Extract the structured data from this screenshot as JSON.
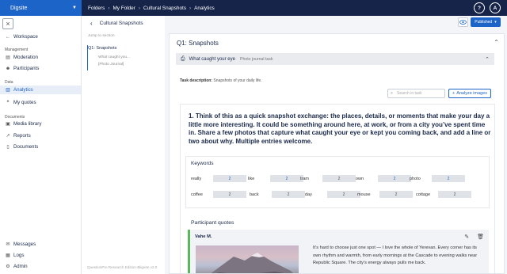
{
  "app": {
    "brand": "Digsite",
    "breadcrumbs": [
      "Folders",
      "My Folder",
      "Cultural Snapshots",
      "Analytics"
    ],
    "help_label": "?",
    "avatar_label": "A"
  },
  "sidebar": {
    "workspace": "Workspace",
    "section_management": "Management",
    "moderation": "Moderation",
    "participants": "Participants",
    "section_data": "Data",
    "analytics": "Analytics",
    "my_quotes": "My quotes",
    "section_documents": "Documents",
    "media_library": "Media library",
    "reports": "Reports",
    "documents": "Documents",
    "messages": "Messages",
    "logs": "Logs",
    "admin": "Admin"
  },
  "outline": {
    "title": "Cultural Snapshots",
    "jump_label": "Jump to section",
    "section": "Q1: Snapshots",
    "sub_items": [
      "What caught you...",
      "[Photo Journal]"
    ],
    "footer": "QuestionPro Research Edition-Bligeite v2.0"
  },
  "toolbar": {
    "publish_label": "Published"
  },
  "main": {
    "question_title": "Q1: Snapshots",
    "task_name": "What caught your eye",
    "task_type": "Photo journal task",
    "task_description_label": "Task description:",
    "task_description": "Snapshots of your daily life.",
    "search_placeholder": "Search in task",
    "analyze_label": "Analyze images",
    "prompt": "1. Think of this as a quick snapshot exchange: the places, details, or moments that make your day a little more interesting. It could be something around here, at work, or from a city you’ve spent time in. Share a few photos that capture what caught your eye or kept you coming back, and add a line or two about why. Multiple entries welcome.",
    "keywords_title": "Keywords",
    "keywords": [
      {
        "word": "really",
        "count": "2"
      },
      {
        "word": "like",
        "count": "2"
      },
      {
        "word": "tram",
        "count": "2"
      },
      {
        "word": "own",
        "count": "2"
      },
      {
        "word": "photo",
        "count": "2"
      },
      {
        "word": "coffee",
        "count": "2"
      },
      {
        "word": "back",
        "count": "2"
      },
      {
        "word": "day",
        "count": "2"
      },
      {
        "word": "mouse",
        "count": "2"
      },
      {
        "word": "cottage",
        "count": "2"
      }
    ],
    "participant_quotes_title": "Participant quotes",
    "quote": {
      "author": "Vahe M.",
      "text": "It’s hard to choose just one spot — I love the whole of Yerevan. Every corner has its own rhythm and warmth, from early mornings at the Cascade to evening walks near Republic Square. The city’s energy always pulls me back."
    }
  }
}
